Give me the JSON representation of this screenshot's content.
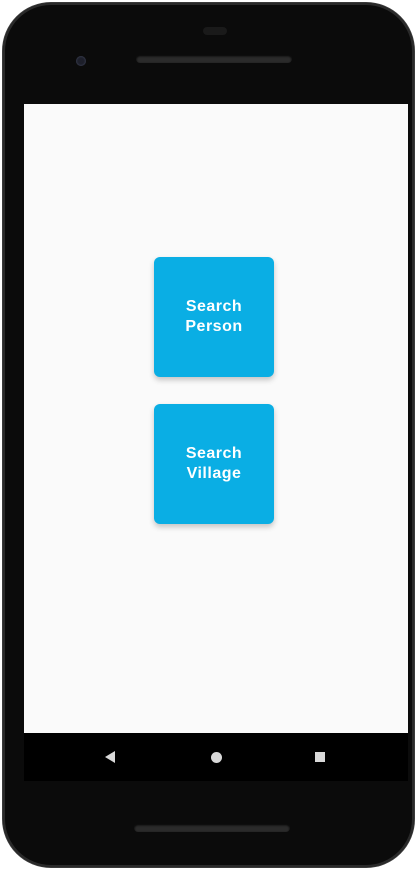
{
  "screen": {
    "buttons": [
      {
        "line1": "Search",
        "line2": "Person"
      },
      {
        "line1": "Search",
        "line2": "Village"
      }
    ],
    "accent_color": "#0aaee4",
    "background_color": "#fafafa"
  },
  "navbar": {
    "back_icon": "back-triangle",
    "home_icon": "home-circle",
    "recents_icon": "recents-square"
  }
}
